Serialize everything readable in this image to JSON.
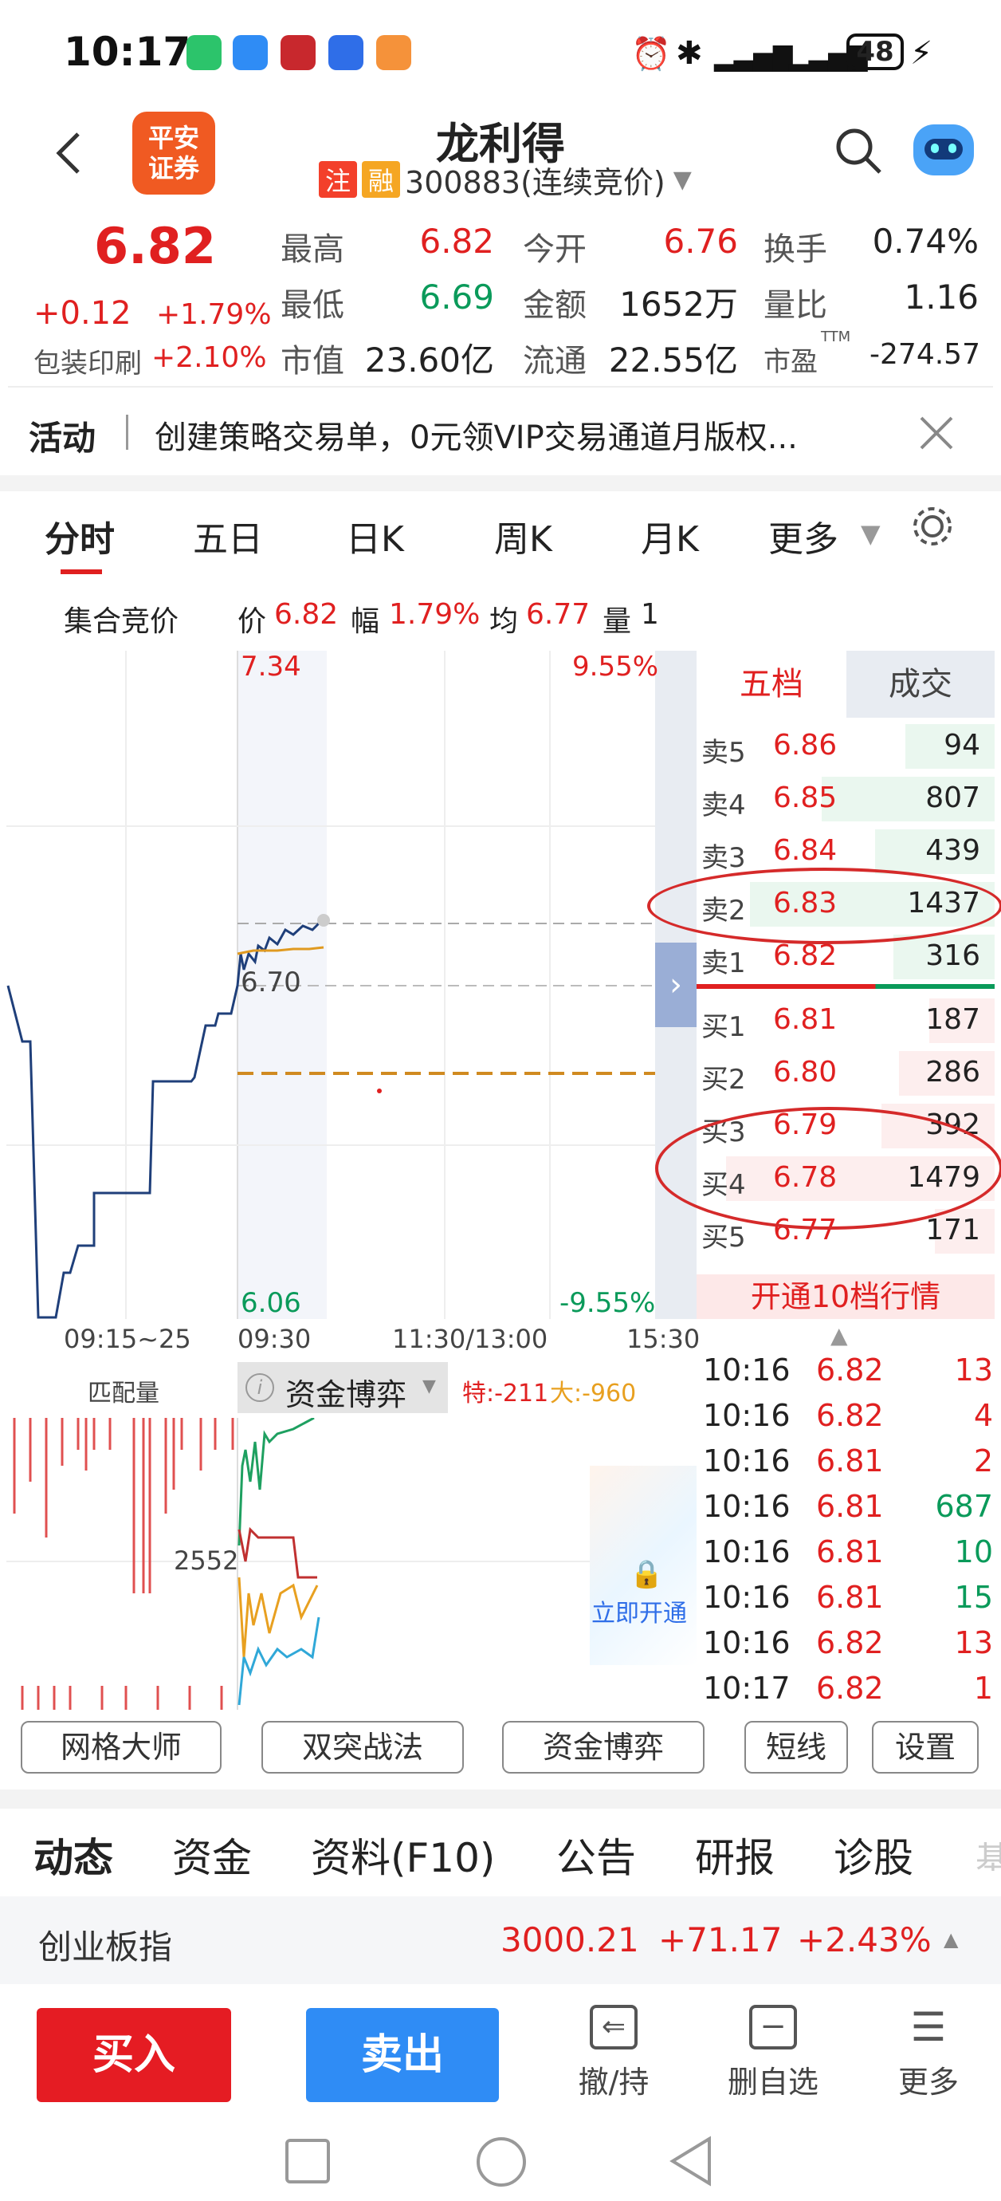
{
  "status": {
    "time": "10:17",
    "battery": "48"
  },
  "header": {
    "title": "龙利得",
    "broker_logo_line1": "平安",
    "broker_logo_line2": "证券",
    "tag_zhu": "注",
    "tag_rong": "融",
    "code": "300883(连续竞价)"
  },
  "quote": {
    "price": "6.82",
    "change": "+0.12",
    "change_pct": "+1.79%",
    "sector": "包装印刷",
    "sector_pct": "+2.10%",
    "high_label": "最高",
    "high": "6.82",
    "open_label": "今开",
    "open": "6.76",
    "turnover_label": "换手",
    "turnover": "0.74%",
    "low_label": "最低",
    "low": "6.69",
    "amount_label": "金额",
    "amount": "1652万",
    "vol_ratio_label": "量比",
    "vol_ratio": "1.16",
    "mcap_label": "市值",
    "mcap": "23.60亿",
    "float_label": "流通",
    "float": "22.55亿",
    "pe_label": "市盈",
    "pe_sup": "TTM",
    "pe": "-274.57"
  },
  "promo": {
    "label": "活动",
    "text": "创建策略交易单，0元领VIP交易通道月版权..."
  },
  "tabs": [
    "分时",
    "五日",
    "日K",
    "周K",
    "月K",
    "更多"
  ],
  "auction": {
    "label": "集合竞价",
    "price_label": "价",
    "price": "6.82",
    "amp_label": "幅",
    "amp": "1.79%",
    "avg_label": "均",
    "avg": "6.77",
    "vol_label": "量",
    "vol": "1"
  },
  "chart_labels": {
    "top_price": "7.34",
    "top_pct": "9.55%",
    "mid_price": "6.70",
    "bottom_price": "6.06",
    "bottom_pct": "-9.55%",
    "t1": "09:15~25",
    "t2": "09:30",
    "t3": "11:30/13:00",
    "t4": "15:30"
  },
  "lower": {
    "label": "匹配量",
    "selector": "资金博弈",
    "te": "特:-211",
    "da": "大:-960",
    "vol_label": "2552",
    "unlock": "立即开通"
  },
  "book": {
    "tab1": "五档",
    "tab2": "成交",
    "asks": [
      [
        "卖5",
        "6.86",
        "94"
      ],
      [
        "卖4",
        "6.85",
        "807"
      ],
      [
        "卖3",
        "6.84",
        "439"
      ],
      [
        "卖2",
        "6.83",
        "1437"
      ],
      [
        "卖1",
        "6.82",
        "316"
      ]
    ],
    "bids": [
      [
        "买1",
        "6.81",
        "187"
      ],
      [
        "买2",
        "6.80",
        "286"
      ],
      [
        "买3",
        "6.79",
        "392"
      ],
      [
        "买4",
        "6.78",
        "1479"
      ],
      [
        "买5",
        "6.77",
        "171"
      ]
    ],
    "upgrade": "开通10档行情"
  },
  "trades": [
    [
      "10:16",
      "6.82",
      "13",
      "r"
    ],
    [
      "10:16",
      "6.82",
      "4",
      "r"
    ],
    [
      "10:16",
      "6.81",
      "2",
      "r"
    ],
    [
      "10:16",
      "6.81",
      "687",
      "g"
    ],
    [
      "10:16",
      "6.81",
      "10",
      "g"
    ],
    [
      "10:16",
      "6.81",
      "15",
      "g"
    ],
    [
      "10:16",
      "6.82",
      "13",
      "r"
    ],
    [
      "10:17",
      "6.82",
      "1",
      "r"
    ]
  ],
  "tools": [
    "网格大师",
    "双突战法",
    "资金博弈",
    "短线",
    "设置"
  ],
  "nav_tabs": [
    "动态",
    "资金",
    "资料(F10)",
    "公告",
    "研报",
    "诊股"
  ],
  "index": {
    "name": "创业板指",
    "value": "3000.21",
    "change": "+71.17",
    "pct": "+2.43%"
  },
  "bottom": {
    "buy": "买入",
    "sell": "卖出",
    "cancel": "撤/持",
    "remove": "删自选",
    "more": "更多"
  },
  "colors": {
    "up": "#e02020",
    "down": "#0a9a5a",
    "buy": "#e51c23",
    "sell": "#2f8cf5"
  }
}
